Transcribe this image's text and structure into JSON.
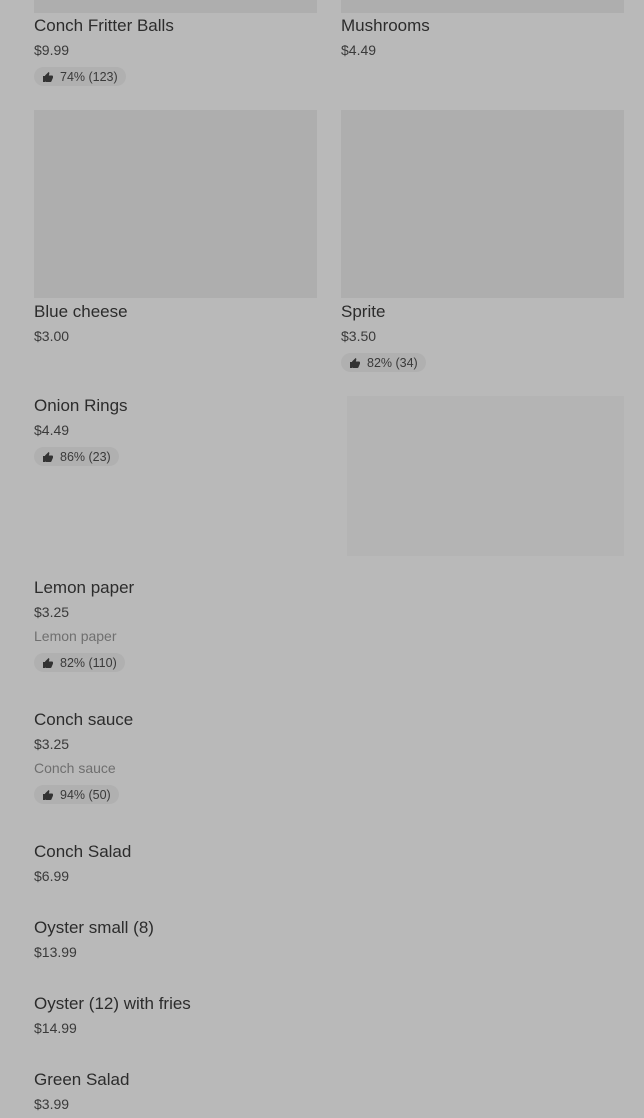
{
  "items": [
    {
      "name": "Conch Fritter Balls",
      "price": "$9.99",
      "rating": "74% (123)"
    },
    {
      "name": "Mushrooms",
      "price": "$4.49"
    },
    {
      "name": "Blue cheese",
      "price": "$3.00"
    },
    {
      "name": "Sprite",
      "price": "$3.50",
      "rating": "82% (34)"
    },
    {
      "name": "Onion Rings",
      "price": "$4.49",
      "rating": "86% (23)"
    },
    {
      "name": "Lemon paper",
      "price": "$3.25",
      "description": "Lemon paper",
      "rating": "82% (110)"
    },
    {
      "name": "Conch sauce",
      "price": "$3.25",
      "description": "Conch sauce",
      "rating": "94% (50)"
    },
    {
      "name": "Conch Salad",
      "price": "$6.99"
    },
    {
      "name": "Oyster small (8)",
      "price": "$13.99"
    },
    {
      "name": "Oyster (12) with fries",
      "price": "$14.99"
    },
    {
      "name": "Green Salad",
      "price": "$3.99"
    }
  ],
  "icons": {
    "rating": "thumbs-up-icon"
  },
  "colors": {
    "background": "#b9b9b9",
    "placeholder": "#aeaeae",
    "text": "#2c2c2c"
  }
}
